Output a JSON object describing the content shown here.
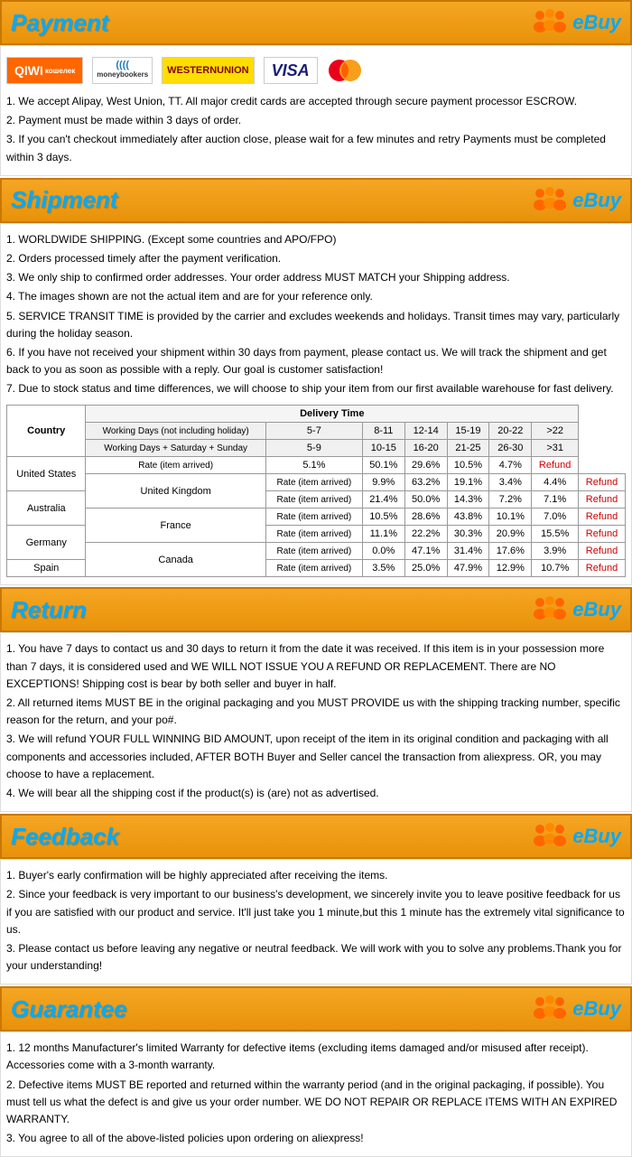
{
  "payment": {
    "title": "Payment",
    "ebuy": "eBuy",
    "items": [
      "1. We accept Alipay, West Union, TT. All major credit cards are accepted through secure payment processor ESCROW.",
      "2. Payment must be made within 3 days of order.",
      "3. If you can't checkout immediately after auction close, please wait for a few minutes and retry Payments must be completed within 3 days."
    ]
  },
  "shipment": {
    "title": "Shipment",
    "ebuy": "eBuy",
    "items": [
      "1. WORLDWIDE SHIPPING. (Except some countries and APO/FPO)",
      "2. Orders processed timely after the payment verification.",
      "3. We only ship to confirmed order addresses. Your order address MUST MATCH your Shipping address.",
      "4. The images shown are not the actual item and are for your reference only.",
      "5. SERVICE TRANSIT TIME is provided by the carrier and excludes weekends and holidays. Transit times may vary, particularly during the holiday season.",
      "6. If you have not received your shipment within 30 days from payment, please contact us. We will track the shipment and get back to you as soon as possible with a reply. Our goal is customer satisfaction!",
      "7. Due to stock status and time differences, we will choose to ship your item from our first available warehouse for fast delivery."
    ],
    "table": {
      "header_label": "Delivery Time",
      "col_country": "Country",
      "col_working_days": "Working Days (not including holiday)",
      "col_working_days_sat": "Working Days + Saturday + Sunday",
      "cols": [
        "5-7",
        "8-11",
        "12-14",
        "15-19",
        "20-22",
        ">22"
      ],
      "cols2": [
        "5-9",
        "10-15",
        "16-20",
        "21-25",
        "26-30",
        ">31"
      ],
      "rows": [
        {
          "country": "United States",
          "rate": "Rate (item arrived)",
          "vals": [
            "5.1%",
            "50.1%",
            "29.6%",
            "10.5%",
            "4.7%",
            "Refund"
          ]
        },
        {
          "country": "United Kingdom",
          "rate": "Rate (item arrived)",
          "vals": [
            "9.9%",
            "63.2%",
            "19.1%",
            "3.4%",
            "4.4%",
            "Refund"
          ]
        },
        {
          "country": "Australia",
          "rate": "Rate (item arrived)",
          "vals": [
            "21.4%",
            "50.0%",
            "14.3%",
            "7.2%",
            "7.1%",
            "Refund"
          ]
        },
        {
          "country": "France",
          "rate": "Rate (item arrived)",
          "vals": [
            "10.5%",
            "28.6%",
            "43.8%",
            "10.1%",
            "7.0%",
            "Refund"
          ]
        },
        {
          "country": "Germany",
          "rate": "Rate (item arrived)",
          "vals": [
            "11.1%",
            "22.2%",
            "30.3%",
            "20.9%",
            "15.5%",
            "Refund"
          ]
        },
        {
          "country": "Canada",
          "rate": "Rate (item arrived)",
          "vals": [
            "0.0%",
            "47.1%",
            "31.4%",
            "17.6%",
            "3.9%",
            "Refund"
          ]
        },
        {
          "country": "Spain",
          "rate": "Rate (item arrived)",
          "vals": [
            "3.5%",
            "25.0%",
            "47.9%",
            "12.9%",
            "10.7%",
            "Refund"
          ]
        }
      ]
    }
  },
  "return": {
    "title": "Return",
    "ebuy": "eBuy",
    "items": [
      "1. You have 7 days to contact us and 30 days to return it from the date it was received. If this item is in your possession more than 7 days, it is considered used and WE WILL NOT ISSUE YOU A REFUND OR REPLACEMENT. There are NO EXCEPTIONS! Shipping cost is bear by both seller and buyer in half.",
      "2. All returned items MUST BE in the original packaging and you MUST PROVIDE us with the shipping tracking number, specific reason for the return, and your po#.",
      "3. We will refund YOUR FULL WINNING BID AMOUNT, upon receipt of the item in its original condition and packaging with all components and accessories included, AFTER BOTH Buyer and Seller cancel the transaction from aliexpress. OR, you may choose to have a replacement.",
      "4. We will bear all the shipping cost if the product(s) is (are) not as advertised."
    ]
  },
  "feedback": {
    "title": "Feedback",
    "ebuy": "eBuy",
    "items": [
      "1. Buyer's early confirmation will be highly appreciated after receiving the items.",
      "2. Since your feedback is very important to our business's development, we sincerely invite you to leave positive feedback for us if you are satisfied with our product and service. It'll just take you 1 minute,but this 1 minute has the extremely vital significance to us.",
      "3. Please contact us before leaving any negative or neutral feedback. We will work with you to solve any problems.Thank you for your understanding!"
    ]
  },
  "guarantee": {
    "title": "Guarantee",
    "ebuy": "eBuy",
    "items": [
      "1. 12 months Manufacturer's limited Warranty for defective items (excluding items damaged and/or misused after receipt). Accessories come with a 3-month warranty.",
      "2. Defective items MUST BE reported and returned within the warranty period (and in the original packaging, if possible). You must tell us what the defect is and give us your order number. WE DO NOT REPAIR OR REPLACE ITEMS WITH AN EXPIRED WARRANTY.",
      "3. You agree to all of the above-listed policies upon ordering on aliexpress!"
    ]
  }
}
